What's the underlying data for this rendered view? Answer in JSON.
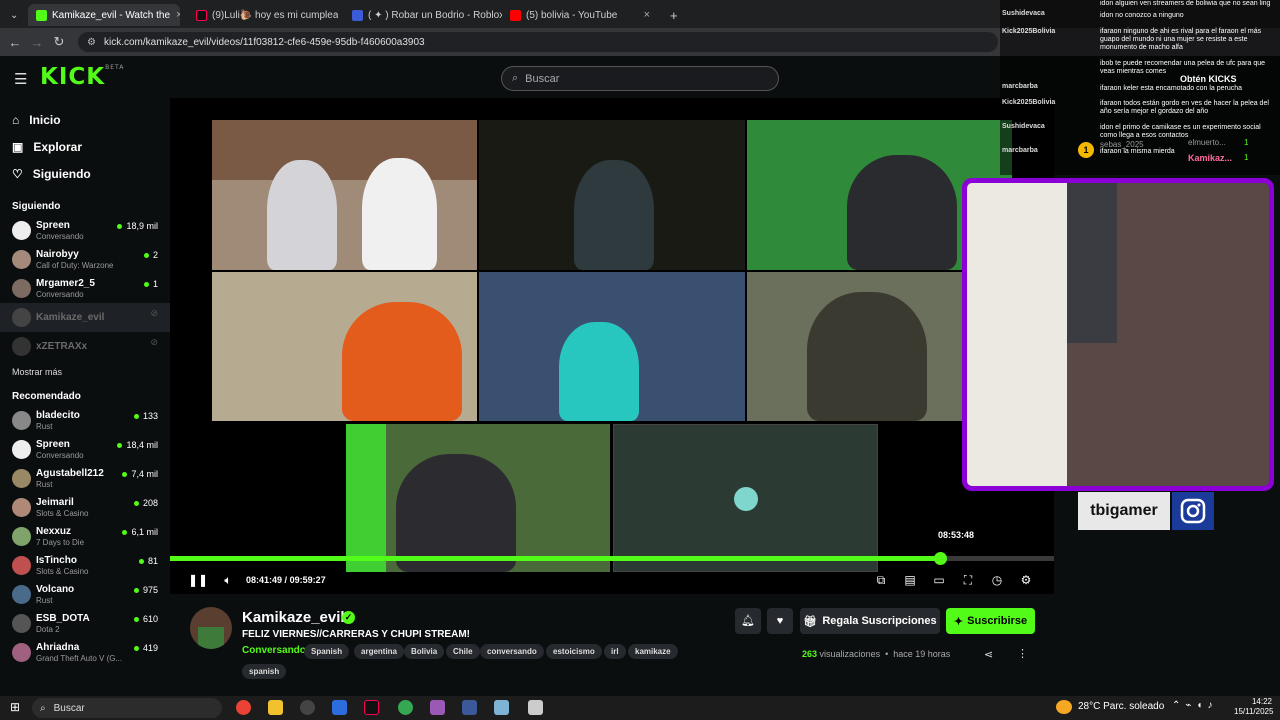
{
  "browser": {
    "tabs": [
      {
        "label": "Kamikaze_evil - Watch the",
        "active": true
      },
      {
        "label": "(9)Luli🐌 hoy es mi cumpleaño",
        "active": false
      },
      {
        "label": "( ✦ ) Robar un Bodrio - Roblox",
        "active": false
      },
      {
        "label": "(5) bolivia - YouTube",
        "active": false
      }
    ],
    "url": "kick.com/kamikaze_evil/videos/11f03812-cfe6-459e-95db-f460600a3903"
  },
  "header": {
    "logo": "KICK",
    "logo_badge": "BETA",
    "search_placeholder": "Buscar"
  },
  "sidebar": {
    "nav": [
      {
        "label": "Inicio",
        "icon": "home-icon"
      },
      {
        "label": "Explorar",
        "icon": "compass-icon"
      },
      {
        "label": "Siguiendo",
        "icon": "heart-icon"
      }
    ],
    "following_title": "Siguiendo",
    "following": [
      {
        "name": "Spreen",
        "game": "Conversando",
        "viewers": "18,9 mil",
        "live": true
      },
      {
        "name": "Nairobyy",
        "game": "Call of Duty: Warzone",
        "viewers": "2",
        "live": true
      },
      {
        "name": "Mrgamer2_5",
        "game": "Conversando",
        "viewers": "1",
        "live": true
      },
      {
        "name": "Kamikaze_evil",
        "game": "",
        "viewers": "",
        "live": false
      },
      {
        "name": "xZETRAXx",
        "game": "",
        "viewers": "",
        "live": false
      }
    ],
    "show_more": "Mostrar más",
    "recommended_title": "Recomendado",
    "recommended": [
      {
        "name": "bladecito",
        "game": "Rust",
        "viewers": "133"
      },
      {
        "name": "Spreen",
        "game": "Conversando",
        "viewers": "18,4 mil"
      },
      {
        "name": "Agustabell212",
        "game": "Rust",
        "viewers": "7,4 mil"
      },
      {
        "name": "Jeimaril",
        "game": "Slots & Casino",
        "viewers": "208"
      },
      {
        "name": "Nexxuz",
        "game": "7 Days to Die",
        "viewers": "6,1 mil"
      },
      {
        "name": "IsTincho",
        "game": "Slots & Casino",
        "viewers": "81"
      },
      {
        "name": "Volcano",
        "game": "Rust",
        "viewers": "975"
      },
      {
        "name": "ESB_DOTA",
        "game": "Dota 2",
        "viewers": "610"
      },
      {
        "name": "Ahriadna",
        "game": "Grand Theft Auto V (G...",
        "viewers": "419"
      }
    ]
  },
  "player": {
    "current_time": "08:41:49",
    "duration": "09:59:27",
    "time_separator": "/",
    "hover_time": "08:53:48",
    "progress": 0.8705,
    "facecam_handle": "tbigamer"
  },
  "chat_overlay": {
    "users": [
      "Sushidevaca",
      "Kick2025Bolivia",
      "marcbarba",
      "Kick2025Bolivia",
      "Sushidevaca",
      "marcbarba"
    ],
    "messages": [
      "idon alguien ven streamers de boliwia que no sean ling",
      "idon no conozco a ninguno",
      "ifaraon ninguno de ahi es rival para el faraon el más guapo del mundo ni una mujer se resiste a este monumento de macho alfa",
      "ibob te puede recomendar una pelea de ufc para que veas mientras comes",
      "ifaraon keler esta encamotado con la peruchа",
      "ifaraon todos están gordo en ves de hacer la pelea del año sería mejor el gordazo del año",
      "idon el primo de camikase es un experimento social como llega a esos contactos",
      "ifaraon la misma mierda"
    ],
    "kicks_label": "Obtén KICKS",
    "leaderboard": [
      {
        "rank": "1",
        "name": "sebas_2025",
        "count": "1"
      },
      {
        "name": "elmuerto...",
        "count": "1"
      },
      {
        "name": "Kamikaz...",
        "count": "1"
      }
    ]
  },
  "stream_info": {
    "channel": "Kamikaze_evil",
    "title": "FELIZ VIERNES//CARRERAS Y CHUPI STREAM!",
    "category": "Conversando",
    "tags": [
      "Spanish",
      "argentina",
      "Bolivia",
      "Chile",
      "conversando",
      "estoicismo",
      "irl",
      "kamikaze",
      "spanish"
    ],
    "gift_label": "Regala Suscripciones",
    "subscribe_label": "Suscribirse",
    "views_count": "263",
    "views_label": "visualizaciones",
    "age": "hace 19 horas"
  },
  "taskbar": {
    "search_placeholder": "Buscar",
    "weather": "28°C",
    "weather_desc": "Parc. soleado",
    "time": "14:22",
    "date": "15/11/2025"
  },
  "colors": {
    "accent": "#53fc18",
    "facecam_border": "#8a00d6",
    "background": "#0b0e0f"
  }
}
